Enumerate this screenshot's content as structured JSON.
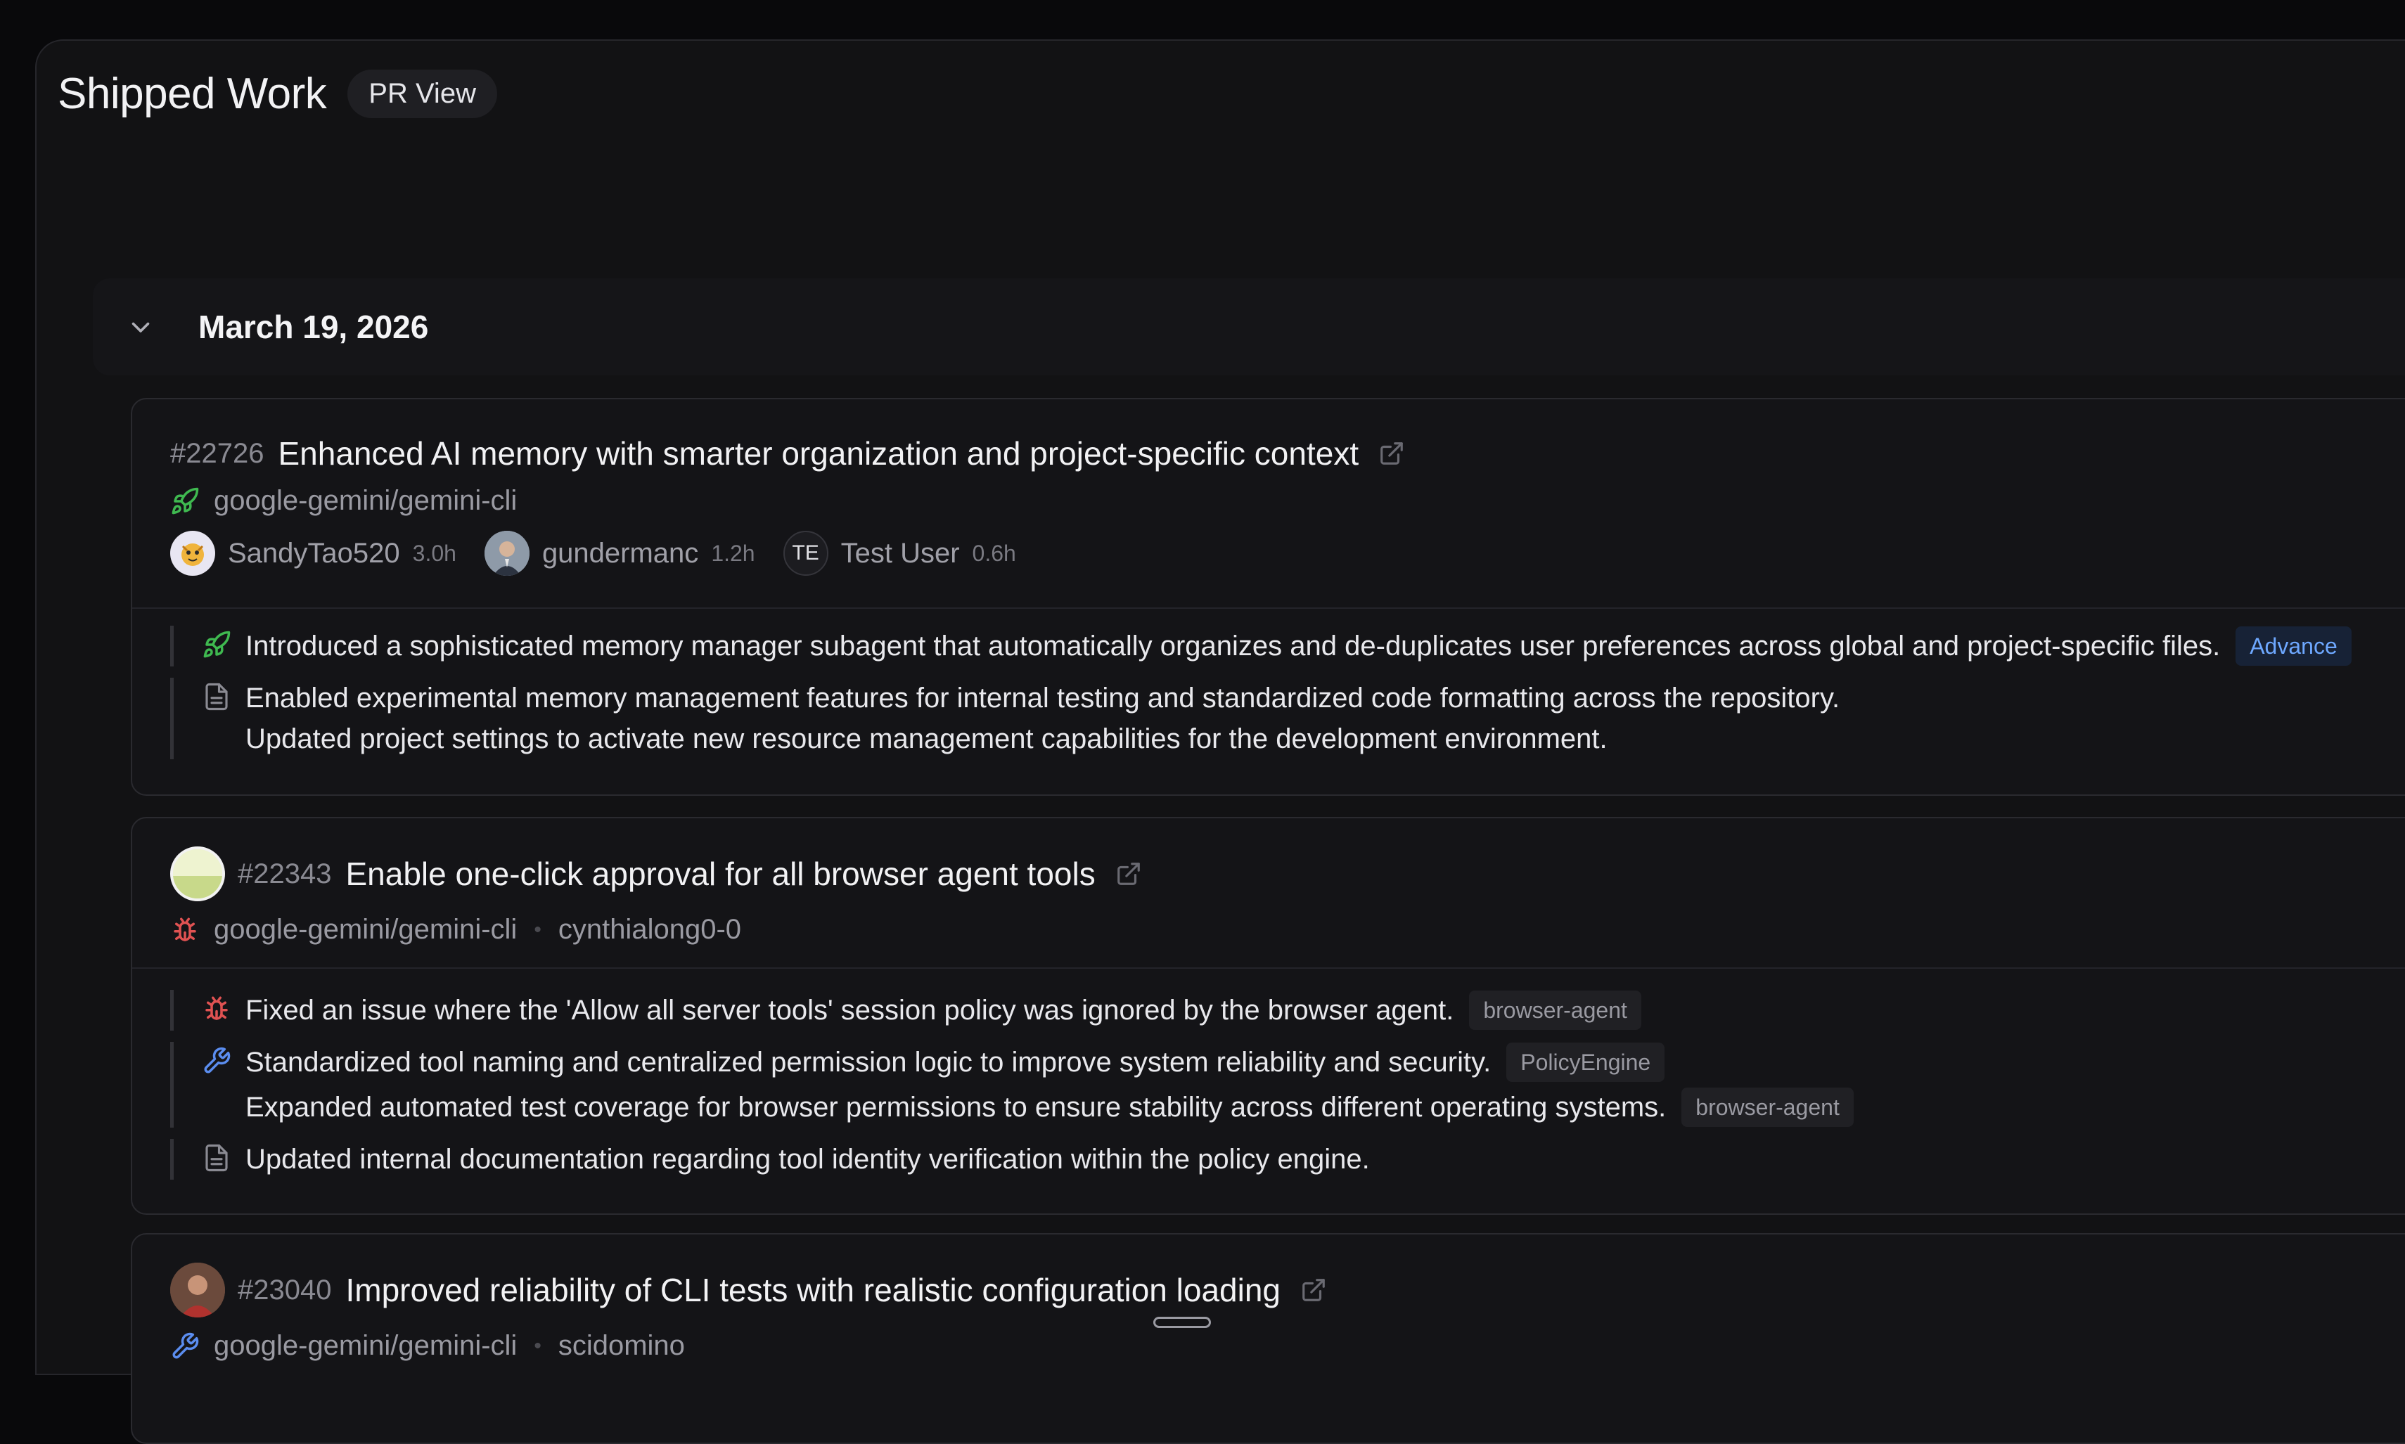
{
  "header": {
    "title": "Shipped Work",
    "view_label": "PR View"
  },
  "date_group": {
    "date": "March 19, 2026"
  },
  "colors": {
    "feature": "#3fb950",
    "bug": "#e05252",
    "tool": "#5b8def",
    "docs": "#8a8a92",
    "tag_blue": "#6ea8ff"
  },
  "prs": [
    {
      "number": "#22726",
      "title": "Enhanced AI memory with smarter organization and project-specific context",
      "repo": "google-gemini/gemini-cli",
      "repo_icon": "rocket-icon",
      "authors": [
        {
          "name": "SandyTao520",
          "time": "3.0h",
          "avatar": "tiger-avatar"
        },
        {
          "name": "gundermanc",
          "time": "1.2h",
          "avatar": "photo-avatar"
        },
        {
          "name": "Test User",
          "time": "0.6h",
          "initials": "TE"
        }
      ],
      "items": [
        {
          "icon": "rocket-icon",
          "lines": [
            {
              "text": "Introduced a sophisticated memory manager subagent that automatically organizes and de-duplicates user preferences across global and project-specific files.",
              "tag": "Advance"
            }
          ]
        },
        {
          "icon": "document-icon",
          "lines": [
            {
              "text": "Enabled experimental memory management features for internal testing and standardized code formatting across the repository."
            },
            {
              "text": "Updated project settings to activate new resource management capabilities for the development environment."
            }
          ]
        }
      ]
    },
    {
      "number": "#22343",
      "title": "Enable one-click approval for all browser agent tools",
      "repo": "google-gemini/gemini-cli",
      "repo_icon": "bug-icon",
      "author": "cynthialong0-0",
      "items": [
        {
          "icon": "bug-icon",
          "lines": [
            {
              "text": "Fixed an issue where the 'Allow all server tools' session policy was ignored by the browser agent.",
              "tag": "browser-agent"
            }
          ]
        },
        {
          "icon": "wrench-icon",
          "lines": [
            {
              "text": "Standardized tool naming and centralized permission logic to improve system reliability and security.",
              "tag": "PolicyEngine"
            },
            {
              "text": "Expanded automated test coverage for browser permissions to ensure stability across different operating systems.",
              "tag": "browser-agent"
            }
          ]
        },
        {
          "icon": "document-icon",
          "lines": [
            {
              "text": "Updated internal documentation regarding tool identity verification within the policy engine."
            }
          ]
        }
      ]
    },
    {
      "number": "#23040",
      "title": "Improved reliability of CLI tests with realistic configuration loading",
      "repo": "google-gemini/gemini-cli",
      "repo_icon": "wrench-icon",
      "author": "scidomino"
    }
  ]
}
